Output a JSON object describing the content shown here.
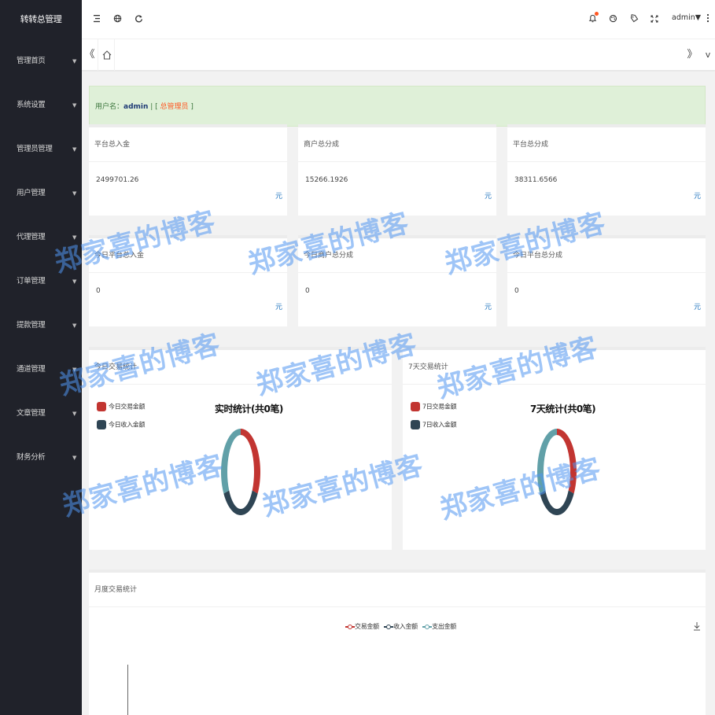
{
  "sidebar": {
    "brand": "转转总管理",
    "items": [
      {
        "label": "管理首页"
      },
      {
        "label": "系统设置"
      },
      {
        "label": "管理员管理"
      },
      {
        "label": "用户管理"
      },
      {
        "label": "代理管理"
      },
      {
        "label": "订单管理"
      },
      {
        "label": "提款管理"
      },
      {
        "label": "通道管理"
      },
      {
        "label": "文章管理"
      },
      {
        "label": "财务分析"
      }
    ],
    "arrow": "▼"
  },
  "header": {
    "icons": [
      "menu-icon",
      "globe-icon",
      "refresh-icon",
      "bell-icon",
      "theme-icon",
      "tag-icon",
      "fullscreen-icon",
      "more-icon"
    ],
    "user": "admin▼"
  },
  "tabs": {
    "left_arrow": "《",
    "right_arrow": "》",
    "dropdown": "v"
  },
  "banner": {
    "prefix": "用户名：",
    "username": "admin",
    "sep": " | [ ",
    "role": "总管理员",
    "suffix": " ]"
  },
  "cards": [
    {
      "title": "平台总入金",
      "value": "2499701.26",
      "unit": "元"
    },
    {
      "title": "商户总分成",
      "value": "15266.1926",
      "unit": "元"
    },
    {
      "title": "平台总分成",
      "value": "38311.6566",
      "unit": "元"
    },
    {
      "title": "今日平台总入金",
      "value": "0",
      "unit": "元"
    },
    {
      "title": "今日商户总分成",
      "value": "0",
      "unit": "元"
    },
    {
      "title": "今日平台总分成",
      "value": "0",
      "unit": "元"
    }
  ],
  "charts": [
    {
      "title": "今日交易统计",
      "donut_title": "实时统计(共0笔)",
      "legend": [
        {
          "label": "今日交易金额",
          "color": "#c23531"
        },
        {
          "label": "今日收入金额",
          "color": "#2f4554"
        }
      ]
    },
    {
      "title": "7天交易统计",
      "donut_title": "7天统计(共0笔)",
      "legend": [
        {
          "label": "7日交易金额",
          "color": "#c23531"
        },
        {
          "label": "7日收入金额",
          "color": "#2f4554"
        }
      ]
    }
  ],
  "chart_data": [
    {
      "type": "pie",
      "title": "实时统计(共0笔)",
      "categories": [
        "今日交易金额",
        "今日收入金额",
        ""
      ],
      "values": [
        1,
        1,
        1
      ],
      "colors": [
        "#c23531",
        "#2f4554",
        "#61a0a8"
      ]
    },
    {
      "type": "pie",
      "title": "7天统计(共0笔)",
      "categories": [
        "7日交易金额",
        "7日收入金额",
        ""
      ],
      "values": [
        1,
        1,
        1
      ],
      "colors": [
        "#c23531",
        "#2f4554",
        "#61a0a8"
      ]
    },
    {
      "type": "line",
      "title": "月度交易统计",
      "series": [
        {
          "name": "交易金额",
          "values": [],
          "color": "#c23531"
        },
        {
          "name": "收入金额",
          "values": [],
          "color": "#2f4554"
        },
        {
          "name": "支出金额",
          "values": [],
          "color": "#61a0a8"
        }
      ]
    }
  ],
  "monthly": {
    "title": "月度交易统计",
    "legend": [
      {
        "label": "交易金额",
        "color": "#c23531"
      },
      {
        "label": "收入金额",
        "color": "#2f4554"
      },
      {
        "label": "支出金额",
        "color": "#61a0a8"
      }
    ]
  },
  "watermark": "郑家喜的博客"
}
